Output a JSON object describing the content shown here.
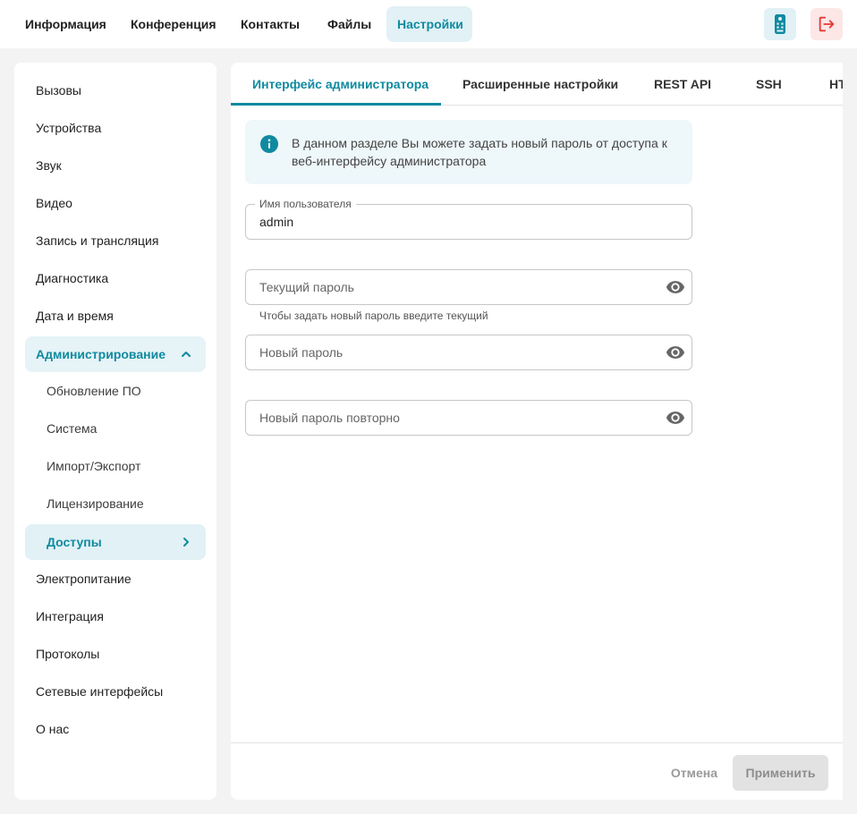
{
  "topnav": {
    "tabs": [
      "Информация",
      "Конференция",
      "Контакты",
      "Файлы",
      "Настройки"
    ],
    "active": "Настройки",
    "icons": {
      "remote": "remote-control-icon",
      "logout": "logout-icon"
    },
    "accent": "#0f8aa0",
    "logout_color": "#e53935"
  },
  "sidebar": {
    "items": [
      {
        "label": "Вызовы"
      },
      {
        "label": "Устройства"
      },
      {
        "label": "Звук"
      },
      {
        "label": "Видео"
      },
      {
        "label": "Запись и трансляция"
      },
      {
        "label": "Диагностика"
      },
      {
        "label": "Дата и время"
      },
      {
        "label": "Администрирование",
        "state": "expanded"
      },
      {
        "label": "Обновление ПО",
        "sub": true
      },
      {
        "label": "Система",
        "sub": true
      },
      {
        "label": "Импорт/Экспорт",
        "sub": true
      },
      {
        "label": "Лицензирование",
        "sub": true
      },
      {
        "label": "Доступы",
        "sub": true,
        "state": "selected"
      },
      {
        "label": "Электропитание"
      },
      {
        "label": "Интеграция"
      },
      {
        "label": "Протоколы"
      },
      {
        "label": "Сетевые интерфейсы"
      },
      {
        "label": "О нас"
      }
    ]
  },
  "main": {
    "tabs": [
      "Интерфейс администратора",
      "Расширенные настройки",
      "REST API",
      "SSH",
      "HTTP"
    ],
    "active_tab": "Интерфейс администратора",
    "info_text": "В данном разделе Вы можете задать новый пароль от доступа к веб-интерфейсу администратора",
    "username": {
      "legend": "Имя пользователя",
      "value": "admin"
    },
    "current_password": {
      "placeholder": "Текущий пароль",
      "helper": "Чтобы задать новый пароль введите текущий"
    },
    "new_password": {
      "placeholder": "Новый пароль"
    },
    "repeat_password": {
      "placeholder": "Новый пароль повторно"
    },
    "footer": {
      "cancel": "Отмена",
      "apply": "Применить"
    }
  }
}
